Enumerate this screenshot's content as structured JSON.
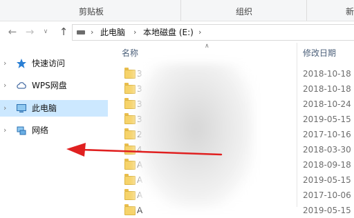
{
  "ribbon": {
    "groups": [
      "剪贴板",
      "组织",
      "新"
    ]
  },
  "navbar": {
    "back_icon": "arrow-left-icon",
    "forward_icon": "arrow-right-icon",
    "recent_icon": "chevron-down-icon",
    "up_icon": "arrow-up-icon",
    "breadcrumb": [
      "此电脑",
      "本地磁盘 (E:)"
    ]
  },
  "navpane": {
    "items": [
      {
        "label": "快速访问",
        "icon": "star-icon"
      },
      {
        "label": "WPS网盘",
        "icon": "cloud-icon"
      },
      {
        "label": "此电脑",
        "icon": "computer-icon",
        "selected": true
      },
      {
        "label": "网络",
        "icon": "network-icon"
      }
    ]
  },
  "content": {
    "headers": {
      "name": "名称",
      "date": "修改日期"
    },
    "rows": [
      {
        "name": "3",
        "date": "2018-10-18"
      },
      {
        "name": "3",
        "date": "2018-10-18"
      },
      {
        "name": "3",
        "date": "2018-10-24"
      },
      {
        "name": "3",
        "date": "2019-05-15"
      },
      {
        "name": "2",
        "date": "2017-10-16"
      },
      {
        "name": "4",
        "date": "2018-03-30"
      },
      {
        "name": "A",
        "date": "2018-09-18"
      },
      {
        "name": "A",
        "date": "2019-05-15"
      },
      {
        "name": "A",
        "date": "2017-10-06"
      },
      {
        "name": "A",
        "date": "2019-05-15"
      }
    ]
  },
  "annotation": {
    "color": "#e02020"
  }
}
